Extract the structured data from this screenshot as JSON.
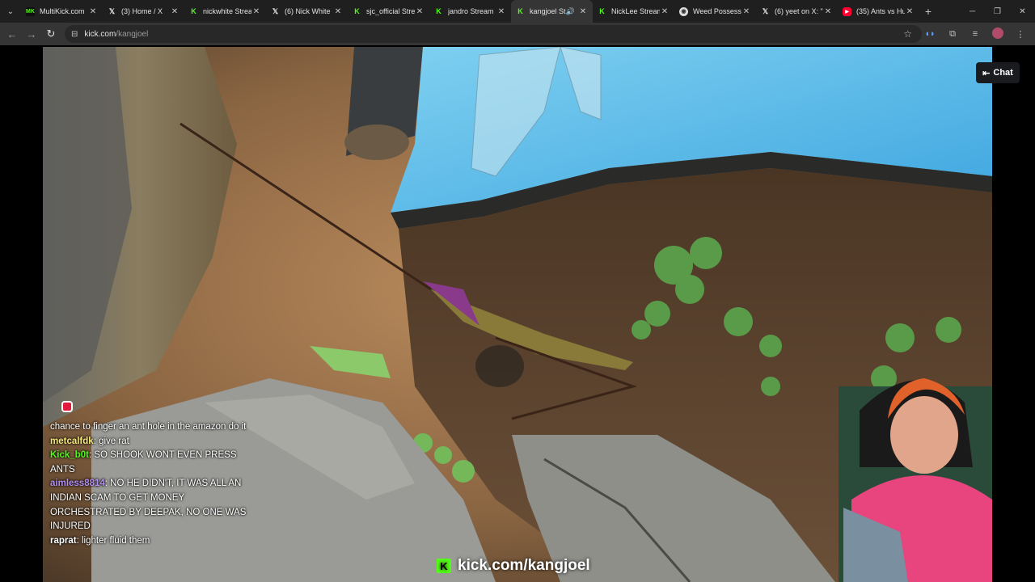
{
  "tabs": [
    {
      "title": "MultiKick.com",
      "favicon": "mk",
      "active": false
    },
    {
      "title": "(3) Home / X",
      "favicon": "x",
      "active": false
    },
    {
      "title": "nickwhite Strea",
      "favicon": "kick",
      "active": false
    },
    {
      "title": "(6) Nick White",
      "favicon": "x",
      "active": false
    },
    {
      "title": "sjc_official Stre",
      "favicon": "kick",
      "active": false
    },
    {
      "title": "jandro Stream",
      "favicon": "kick",
      "active": false
    },
    {
      "title": "kangjoel St",
      "favicon": "kick",
      "active": true
    },
    {
      "title": "NickLee Stream",
      "favicon": "kick",
      "active": false
    },
    {
      "title": "Weed Possessi",
      "favicon": "weed",
      "active": false
    },
    {
      "title": "(6) yeet on X: \"",
      "favicon": "x",
      "active": false
    },
    {
      "title": "(35) Ants vs Hu",
      "favicon": "yt",
      "active": false
    }
  ],
  "address": {
    "host": "kick.com",
    "path": "/kangjoel"
  },
  "chat_button": {
    "label": "Chat"
  },
  "chat": [
    {
      "user": "",
      "color": "#ffffff",
      "text": "chance to finger an ant hole in the amazon do it"
    },
    {
      "user": "metcalfdk",
      "color": "#f7e87b",
      "text": ": give rat"
    },
    {
      "user": "Kick_b0t",
      "color": "#53fc18",
      "text": ": SO SHOOK WONT EVEN PRESS ANTS"
    },
    {
      "user": "aimless8814",
      "color": "#b48ff0",
      "text": ": NO HE DIDN'T, IT WAS ALL AN INDIAN SCAM TO GET MONEY ORCHESTRATED BY DEEPAK, NO ONE WAS INJURED"
    },
    {
      "user": "raprat",
      "color": "#ffffff",
      "text": ": lighter fluid them"
    }
  ],
  "watermark": {
    "text": "kick.com/kangjoel"
  },
  "colors": {
    "kick_green": "#53fc18",
    "tab_bg": "#1f1f1f",
    "toolbar_bg": "#353535"
  }
}
